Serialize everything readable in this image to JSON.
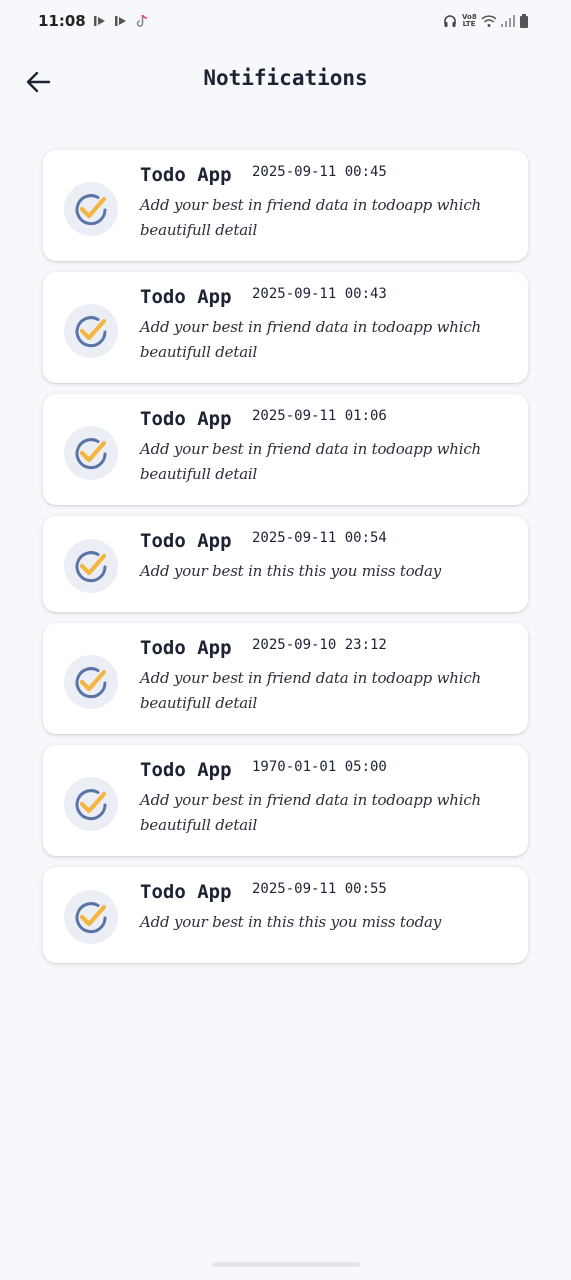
{
  "status_bar": {
    "time": "11:08",
    "network_label": "Vo8 LTE"
  },
  "header": {
    "title": "Notifications"
  },
  "colors": {
    "check_stroke": "#f4b63f",
    "circle_stroke": "#5b74a8",
    "icon_bg": "#eceef6"
  },
  "notifications": [
    {
      "title": "Todo App",
      "time": "2025-09-11 00:45",
      "message": "Add your best in friend data in todoapp which beautifull detail"
    },
    {
      "title": "Todo App",
      "time": "2025-09-11 00:43",
      "message": "Add your best in friend data in todoapp which beautifull detail"
    },
    {
      "title": "Todo App",
      "time": "2025-09-11 01:06",
      "message": "Add your best in friend data in todoapp which beautifull detail"
    },
    {
      "title": "Todo App",
      "time": "2025-09-11 00:54",
      "message": "Add your best in this this you miss today"
    },
    {
      "title": "Todo App",
      "time": "2025-09-10 23:12",
      "message": "Add your best in friend data in todoapp which beautifull detail"
    },
    {
      "title": "Todo App",
      "time": "1970-01-01 05:00",
      "message": "Add your best in friend data in todoapp which beautifull detail"
    },
    {
      "title": "Todo App",
      "time": "2025-09-11 00:55",
      "message": "Add your best in this this you miss today"
    }
  ]
}
